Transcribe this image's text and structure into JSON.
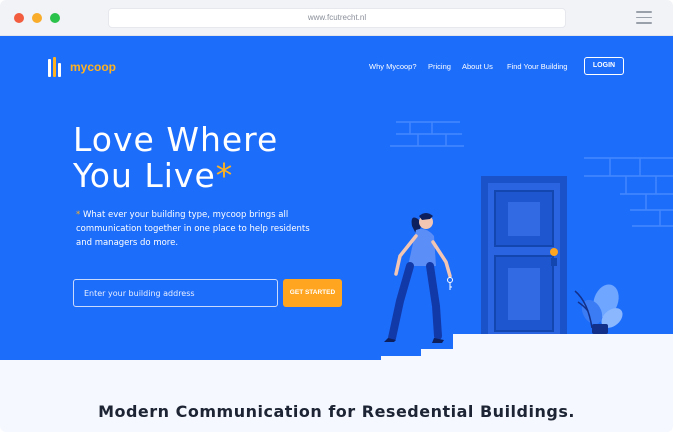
{
  "browser": {
    "url": "www.fcutrecht.nl"
  },
  "brand": {
    "name": "mycoop",
    "accent": "#ffb21f",
    "primary": "#1d6dfb"
  },
  "nav": {
    "items": [
      {
        "label": "Why Mycoop?"
      },
      {
        "label": "Pricing"
      },
      {
        "label": "About Us"
      },
      {
        "label": "Find Your Building"
      }
    ],
    "login_label": "LOGIN"
  },
  "hero": {
    "headline_line1": "Love Where",
    "headline_line2": "You Live",
    "headline_asterisk": "*",
    "description_asterisk": "*",
    "description": "What ever your building type, mycoop brings all communication together in one place to help residents and managers do more.",
    "address_placeholder": "Enter your building address",
    "cta_label": "GET STARTED"
  },
  "section": {
    "title": "Modern Communication for Resedential Buildings."
  },
  "icons": [
    "logo-icon",
    "hamburger-menu-icon",
    "door-illustration",
    "woman-illustration",
    "plant-illustration",
    "key-icon"
  ]
}
